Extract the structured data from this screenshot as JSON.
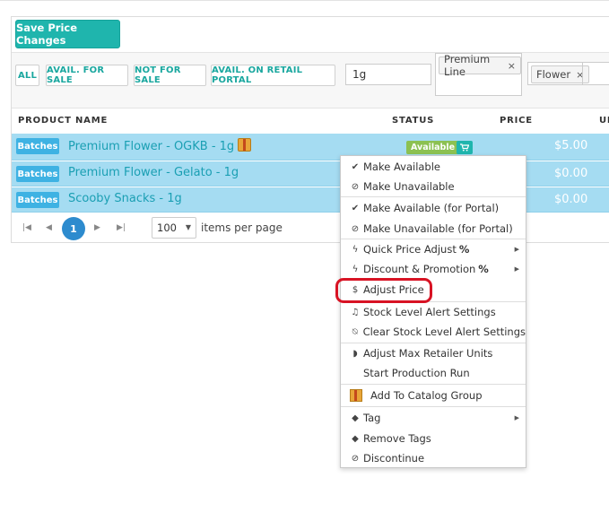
{
  "toolbar": {
    "save_label": "Save Price Changes"
  },
  "filters": {
    "buttons": [
      "ALL",
      "AVAIL. FOR SALE",
      "NOT FOR SALE",
      "AVAIL. ON RETAIL PORTAL"
    ],
    "search_value": "1g",
    "tags_1": [
      "Premium Line"
    ],
    "tags_2": [
      "Flower"
    ],
    "remove_glyph": "×"
  },
  "table": {
    "headers": [
      "PRODUCT NAME",
      "STATUS",
      "PRICE",
      "UN"
    ],
    "rows": [
      {
        "batch_label": "Batches",
        "name": "Premium Flower - OGKB - 1g",
        "status": "Available",
        "price": "$5.00"
      },
      {
        "batch_label": "Batches",
        "name": "Premium Flower - Gelato - 1g",
        "price": "$0.00"
      },
      {
        "batch_label": "Batches",
        "name": "Scooby Snacks - 1g",
        "price": "$0.00"
      }
    ]
  },
  "pager": {
    "current_page": "1",
    "page_size": "100",
    "label": "items per page"
  },
  "context_menu": {
    "items": [
      {
        "label": "Make Available",
        "icon": "check-circle-icon"
      },
      {
        "label": "Make Unavailable",
        "icon": "ban-icon"
      },
      {
        "label": "Make Available (for Portal)",
        "icon": "check-circle-icon"
      },
      {
        "label": "Make Unavailable (for Portal)",
        "icon": "ban-icon"
      },
      {
        "label": "Quick Price Adjust",
        "suffix": "%",
        "icon": "bolt-icon",
        "submenu": true
      },
      {
        "label": "Discount & Promotion",
        "suffix": "%",
        "icon": "bolt-icon",
        "submenu": true
      },
      {
        "label": "Adjust Price",
        "icon": "dollar-icon",
        "highlighted": true
      },
      {
        "label": "Stock Level Alert Settings",
        "icon": "bell-icon"
      },
      {
        "label": "Clear Stock Level Alert Settings",
        "icon": "bell-slash-icon"
      },
      {
        "label": "Adjust Max Retailer Units",
        "icon": "shield-icon"
      },
      {
        "label": "Start Production Run",
        "icon": ""
      },
      {
        "label": "Add To Catalog Group",
        "icon": "catalog-box-icon"
      },
      {
        "label": "Tag",
        "icon": "tags-icon",
        "submenu": true
      },
      {
        "label": "Remove Tags",
        "icon": "tags-icon"
      },
      {
        "label": "Discontinue",
        "icon": "ban-icon"
      }
    ]
  },
  "colors": {
    "accent": "#1fb5ad",
    "row_selected": "#a5dcf2",
    "batch_badge": "#3eb2e3",
    "available_badge": "#8cc152",
    "page_active": "#2d8bce",
    "highlight_ring": "#d81324"
  }
}
